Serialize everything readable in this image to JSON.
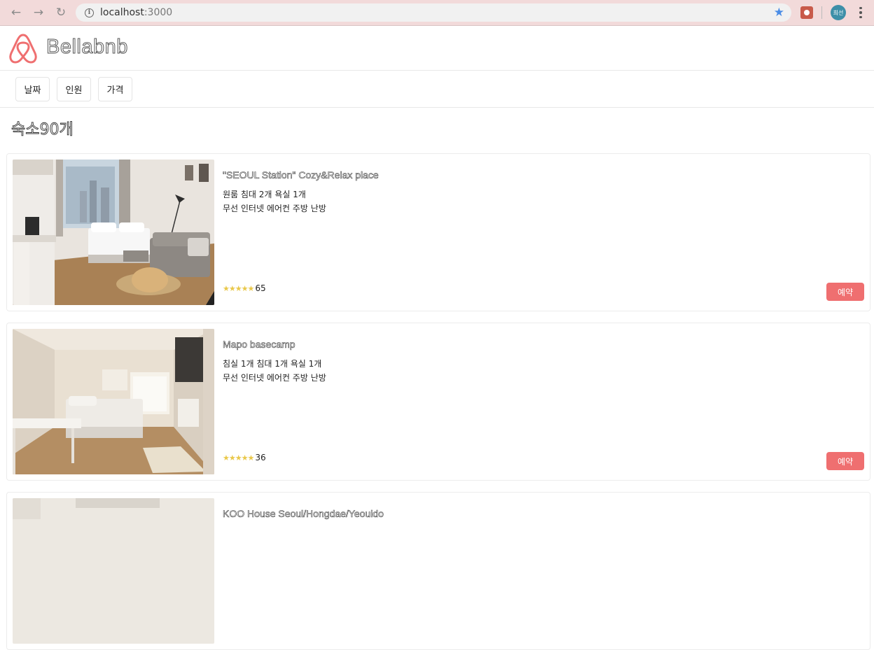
{
  "browser": {
    "url_host": "localhost",
    "url_port": ":3000",
    "profile_label": "희선",
    "accent": "#4a8ce6"
  },
  "app": {
    "brand": "Bellabnb",
    "brand_color": "#ef6f70"
  },
  "filters": [
    {
      "label": "날짜"
    },
    {
      "label": "인원"
    },
    {
      "label": "가격"
    }
  ],
  "listing_count_title": "숙소90개",
  "listings": [
    {
      "title": "\"SEOUL Station\" Cozy&Relax place",
      "rooms": "원룸 침대 2개 욕실 1개",
      "amenities": "무선 인터넷 에어컨 주방 난방",
      "stars": "★★★★★",
      "reviews": "65",
      "book_label": "예약"
    },
    {
      "title": "Mapo basecamp",
      "rooms": "침실 1개 침대 1개 욕실 1개",
      "amenities": "무선 인터넷 에어컨 주방 난방",
      "stars": "★★★★★",
      "reviews": "36",
      "book_label": "예약"
    },
    {
      "title": "KOO House Seoul/Hongdae/Yeouido"
    }
  ]
}
